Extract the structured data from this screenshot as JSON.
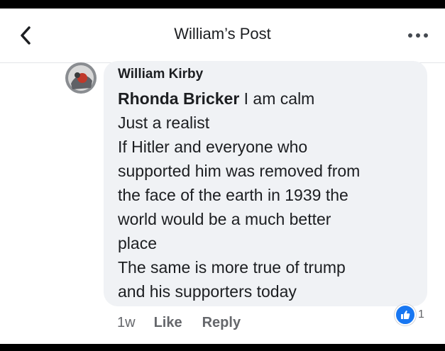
{
  "header": {
    "title": "William’s Post",
    "back_icon": "chevron-left-icon",
    "more_icon": "ellipsis-icon"
  },
  "comment": {
    "author": "William Kirby",
    "mention": "Rhonda Bricker",
    "lines": [
      " I am calm",
      "Just a realist",
      "If Hitler and everyone who",
      "supported him was removed from",
      "the face of the earth in 1939 the",
      "world would be a much better",
      "place",
      "The same is more true of trump",
      "and his supporters today"
    ],
    "time": "1w",
    "like_label": "Like",
    "reply_label": "Reply",
    "reaction_icon": "thumbs-up-icon",
    "reaction_count": "1"
  },
  "colors": {
    "bubble": "#f0f2f5",
    "text": "#1c1e21",
    "meta": "#65676b",
    "like_blue": "#1877f2"
  }
}
